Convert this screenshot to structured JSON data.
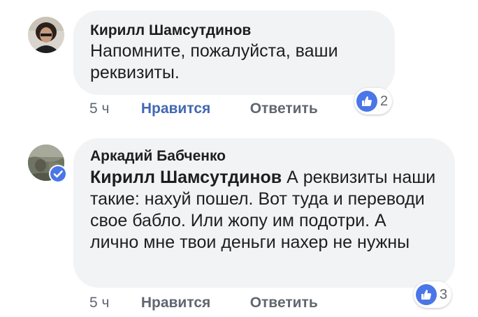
{
  "colors": {
    "bubble_bg": "#f2f3f5",
    "liked_blue": "#4267b2",
    "like_icon_blue": "#4a76e8",
    "meta_gray": "#606770"
  },
  "comments": [
    {
      "author": "Кирилл Шамсутдинов",
      "text": "Напомните, пожалуйста, ваши реквизиты.",
      "time": "5 ч",
      "like_label": "Нравится",
      "like_active": true,
      "reply_label": "Ответить",
      "reactions": {
        "icon": "thumbs-up-icon",
        "count": "2"
      }
    },
    {
      "author": "Аркадий Бабченко",
      "verified": true,
      "mention": "Кирилл Шамсутдинов",
      "text": " А реквизиты наши такие: нахуй пошел. Вот туда и переводи свое бабло. Или жопу им подотри. А лично мне твои деньги нахер не нужны",
      "time": "5 ч",
      "like_label": "Нравится",
      "like_active": false,
      "reply_label": "Ответить",
      "reactions": {
        "icon": "thumbs-up-icon",
        "count": "3"
      }
    }
  ]
}
